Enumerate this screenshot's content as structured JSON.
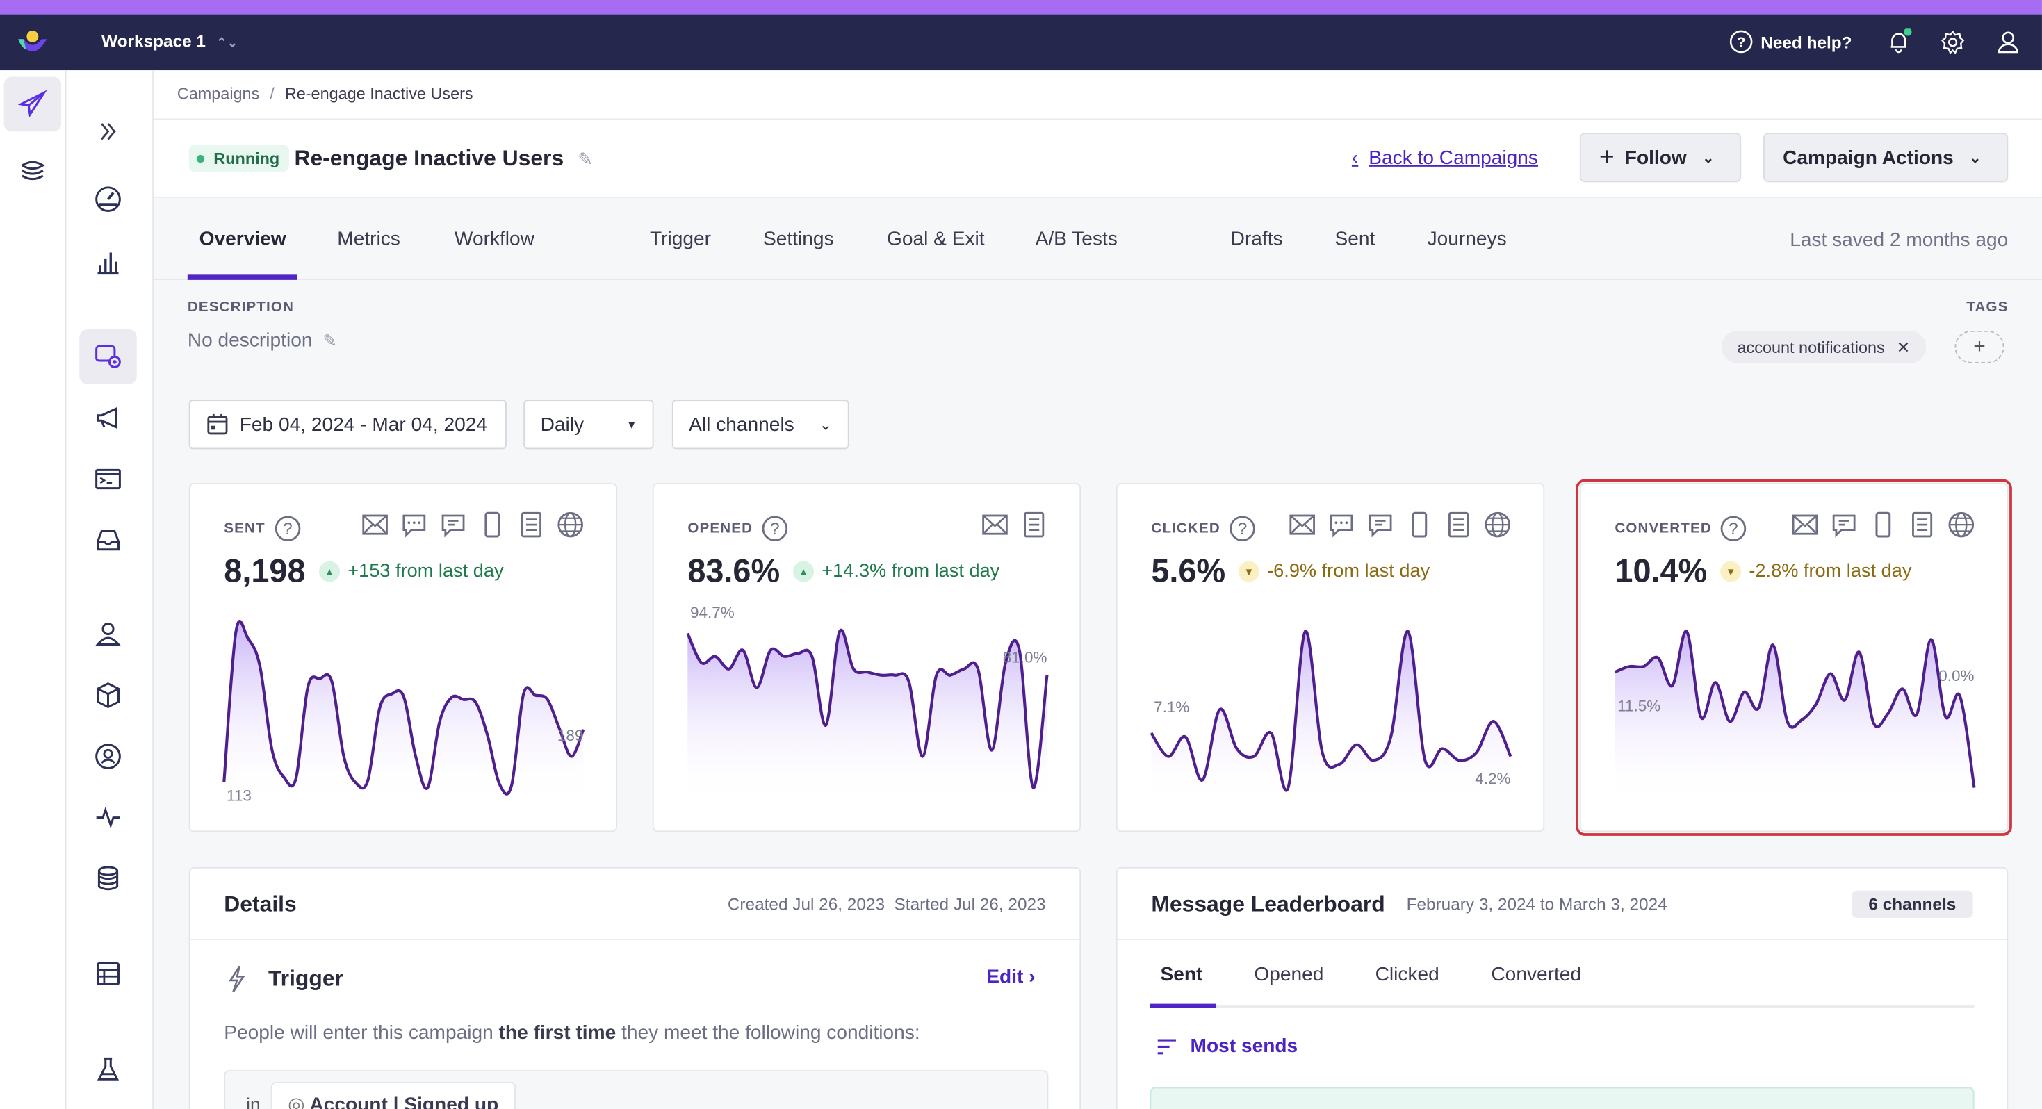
{
  "topnav": {
    "workspace": "Workspace 1",
    "help": "Need help?"
  },
  "breadcrumb": {
    "parent": "Campaigns",
    "sep": "/",
    "current": "Re-engage Inactive Users"
  },
  "header": {
    "status": "Running",
    "title": "Re-engage Inactive Users",
    "back": "Back to Campaigns",
    "follow": "Follow",
    "actions": "Campaign Actions"
  },
  "tabs": [
    "Overview",
    "Metrics",
    "Workflow",
    "Trigger",
    "Settings",
    "Goal & Exit",
    "A/B Tests",
    "Drafts",
    "Sent",
    "Journeys"
  ],
  "active_tab": "Overview",
  "last_saved": "Last saved 2 months ago",
  "description": {
    "label": "DESCRIPTION",
    "value": "No description"
  },
  "tags": {
    "label": "TAGS",
    "items": [
      "account notifications"
    ]
  },
  "filters": {
    "date_range": "Feb 04, 2024 - Mar 04, 2024",
    "interval": "Daily",
    "channels": "All channels"
  },
  "colors": {
    "accent": "#5024c6",
    "line": "#4f1f8e",
    "highlight": "#d0343f",
    "up": "#1e7a4d",
    "down": "#8a6b12"
  },
  "cards": [
    {
      "title": "SENT",
      "value": "8,198",
      "trend": "up",
      "change": "+153 from last day",
      "icons": [
        "email-icon",
        "push-icon",
        "sms-icon",
        "mobile-icon",
        "inbox-icon",
        "web-icon"
      ],
      "start_label": "113",
      "end_label": "189",
      "spark": [
        113,
        330,
        320,
        280,
        160,
        120,
        118,
        250,
        262,
        258,
        150,
        112,
        115,
        220,
        240,
        236,
        150,
        105,
        200,
        235,
        232,
        228,
        180,
        110,
        108,
        240,
        238,
        232,
        190,
        150,
        189
      ]
    },
    {
      "title": "OPENED",
      "value": "83.6%",
      "trend": "up",
      "change": "+14.3% from last day",
      "icons": [
        "email-icon",
        "inbox-icon"
      ],
      "start_label": "94.7%",
      "end_label": "81.0%",
      "spark": [
        94.7,
        90,
        91,
        89,
        92,
        86,
        92,
        91,
        91.5,
        91,
        80,
        95,
        89,
        88.5,
        88,
        88,
        87,
        75,
        88,
        88,
        89,
        89,
        76,
        90,
        92,
        70,
        88
      ]
    },
    {
      "title": "CLICKED",
      "value": "5.6%",
      "trend": "down",
      "change": "-6.9% from last day",
      "icons": [
        "email-icon",
        "push-icon",
        "sms-icon",
        "mobile-icon",
        "inbox-icon",
        "web-icon"
      ],
      "start_label": "7.1%",
      "end_label": "4.2%",
      "spark": [
        5.8,
        4.6,
        5.6,
        3.4,
        7.0,
        5.0,
        4.6,
        5.8,
        3.0,
        11.0,
        4.8,
        4.2,
        5.2,
        4.4,
        5.6,
        11.0,
        4.4,
        5.0,
        4.4,
        4.8,
        6.4,
        4.6
      ]
    },
    {
      "title": "CONVERTED",
      "value": "10.4%",
      "trend": "down",
      "change": "-2.8% from last day",
      "icons": [
        "email-icon",
        "sms-icon",
        "mobile-icon",
        "inbox-icon",
        "web-icon"
      ],
      "start_label": "11.5%",
      "end_label": "0.0%",
      "highlighted": true,
      "spark": [
        14.5,
        15.2,
        15.2,
        16.3,
        12.8,
        19.6,
        8.8,
        13.2,
        8.3,
        12.0,
        10.0,
        17.9,
        8.3,
        8.5,
        10.5,
        14.3,
        11.0,
        17.0,
        8.1,
        9.3,
        12.4,
        9.2,
        18.6,
        8.9,
        11.5,
        0.0
      ]
    }
  ],
  "details": {
    "title": "Details",
    "created": "Created Jul 26, 2023",
    "started": "Started Jul 26, 2023",
    "trigger_title": "Trigger",
    "edit": "Edit",
    "sentence_pre": "People will enter this campaign ",
    "sentence_bold": "the first time",
    "sentence_post": " they meet the following conditions:",
    "cond_in": "in",
    "cond_value": "Account | Signed up"
  },
  "leaderboard": {
    "title": "Message Leaderboard",
    "range": "February 3, 2024 to March 3, 2024",
    "channels": "6 channels",
    "tabs": [
      "Sent",
      "Opened",
      "Clicked",
      "Converted"
    ],
    "sort": "Most sends"
  }
}
